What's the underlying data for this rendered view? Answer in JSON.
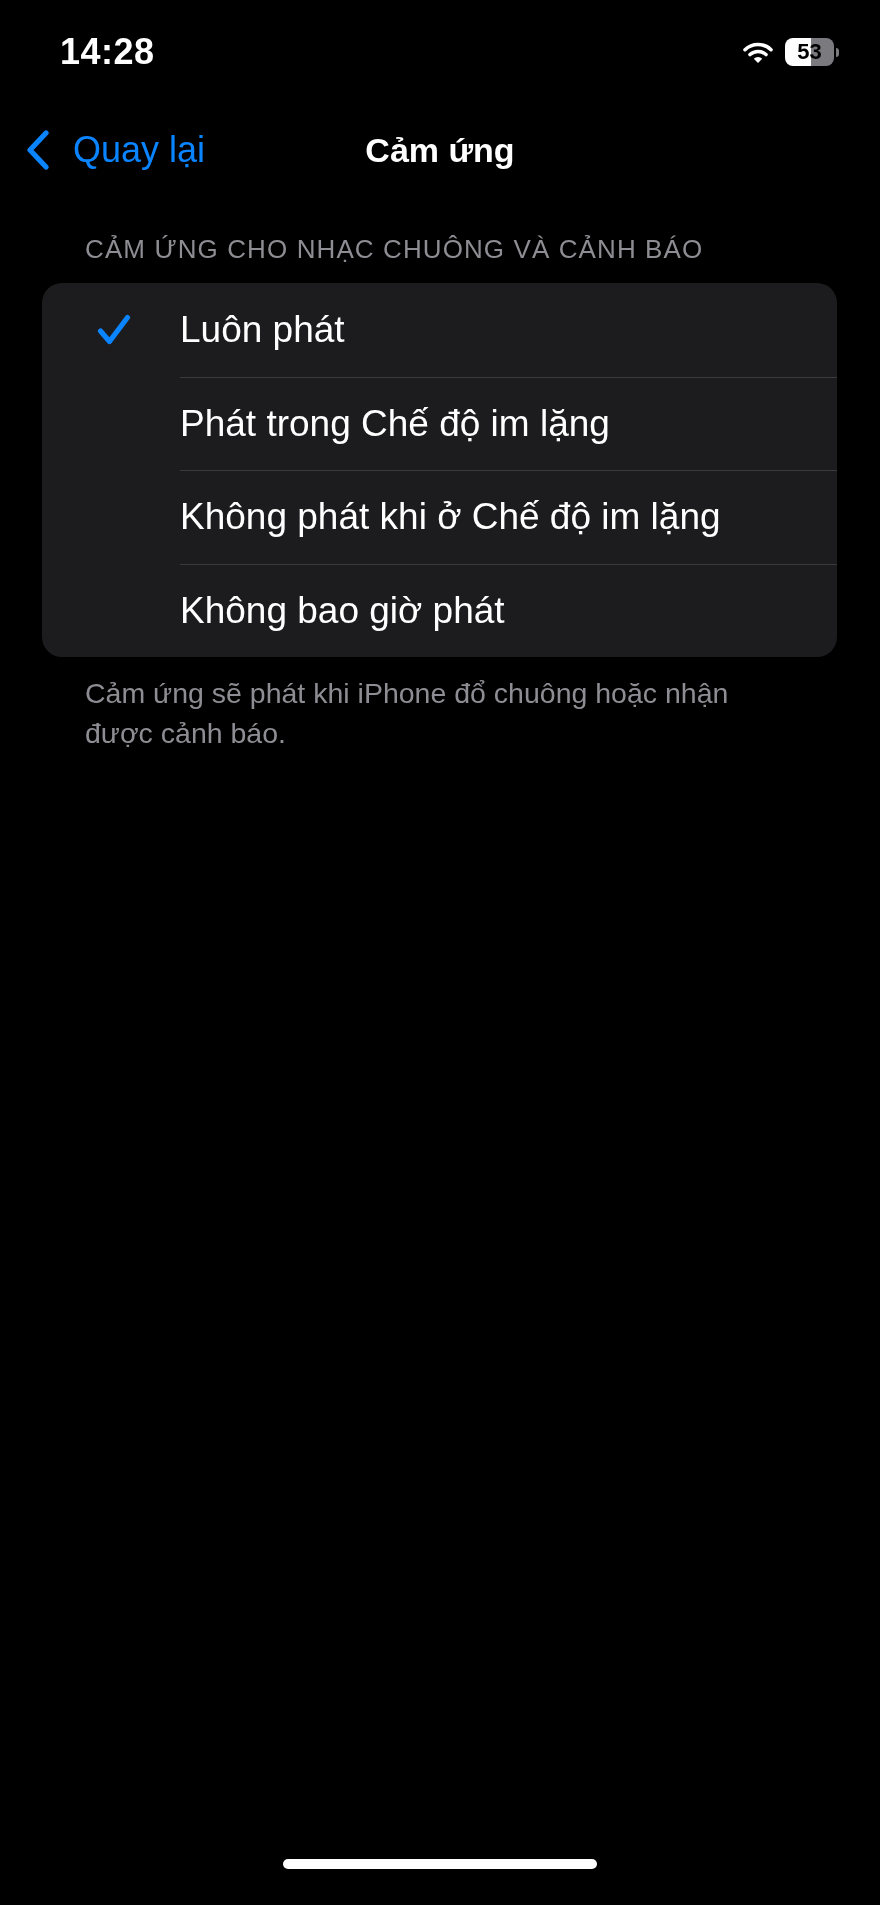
{
  "status_bar": {
    "time": "14:28",
    "battery": "53"
  },
  "nav_bar": {
    "back_label": "Quay lại",
    "title": "Cảm ứng"
  },
  "section": {
    "header": "CẢM ỨNG CHO NHẠC CHUÔNG VÀ CẢNH BÁO",
    "options": [
      {
        "label": "Luôn phát",
        "selected": true
      },
      {
        "label": "Phát trong Chế độ im lặng",
        "selected": false
      },
      {
        "label": "Không phát khi ở Chế độ im lặng",
        "selected": false
      },
      {
        "label": "Không bao giờ phát",
        "selected": false
      }
    ],
    "footer": "Cảm ứng sẽ phát khi iPhone đổ chuông hoặc nhận được cảnh báo."
  }
}
